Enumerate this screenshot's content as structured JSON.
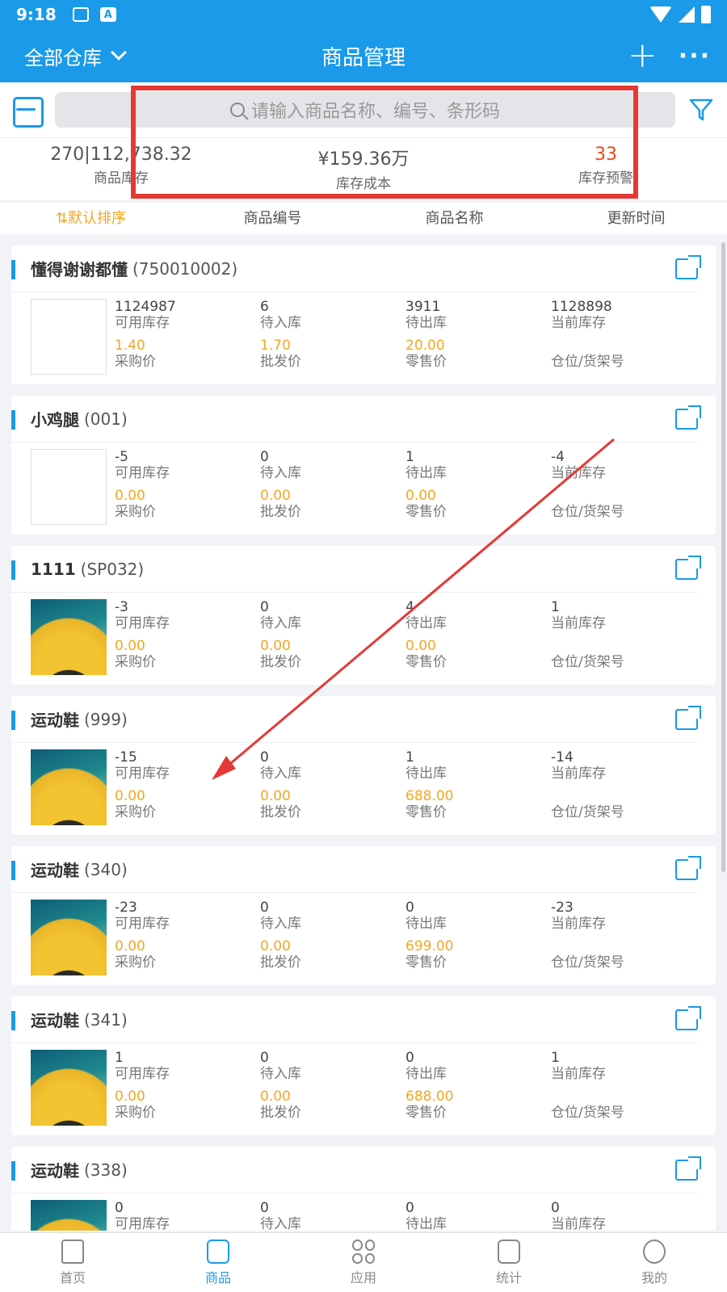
{
  "status_bar": {
    "time": "9:18"
  },
  "app_bar": {
    "warehouse": "全部仓库",
    "title": "商品管理"
  },
  "search": {
    "placeholder": "请输入商品名称、编号、条形码"
  },
  "summary": [
    {
      "value": "270|112,738.32",
      "label": "商品库存"
    },
    {
      "value": "¥159.36万",
      "label": "库存成本"
    },
    {
      "value": "33",
      "label": "库存预警"
    }
  ],
  "sort_tabs": [
    "⇅默认排序",
    "商品编号",
    "商品名称",
    "更新时间"
  ],
  "field_labels": {
    "available": "可用库存",
    "incoming": "待入库",
    "outgoing": "待出库",
    "current": "当前库存",
    "purchase": "采购价",
    "wholesale": "批发价",
    "retail": "零售价",
    "location": "仓位/货架号"
  },
  "products": [
    {
      "name": "懂得谢谢都懂",
      "code": "(750010002)",
      "image": false,
      "available": "1124987",
      "incoming": "6",
      "outgoing": "3911",
      "current": "1128898",
      "purchase": "1.40",
      "wholesale": "1.70",
      "retail": "20.00"
    },
    {
      "name": "小鸡腿",
      "code": "(001)",
      "image": false,
      "available": "-5",
      "incoming": "0",
      "outgoing": "1",
      "current": "-4",
      "purchase": "0.00",
      "wholesale": "0.00",
      "retail": "0.00"
    },
    {
      "name": "1111",
      "code": "(SP032)",
      "image": true,
      "available": "-3",
      "incoming": "0",
      "outgoing": "4",
      "current": "1",
      "purchase": "0.00",
      "wholesale": "0.00",
      "retail": "0.00"
    },
    {
      "name": "运动鞋",
      "code": "(999)",
      "image": true,
      "available": "-15",
      "incoming": "0",
      "outgoing": "1",
      "current": "-14",
      "purchase": "0.00",
      "wholesale": "0.00",
      "retail": "688.00"
    },
    {
      "name": "运动鞋",
      "code": "(340)",
      "image": true,
      "available": "-23",
      "incoming": "0",
      "outgoing": "0",
      "current": "-23",
      "purchase": "0.00",
      "wholesale": "0.00",
      "retail": "699.00"
    },
    {
      "name": "运动鞋",
      "code": "(341)",
      "image": true,
      "available": "1",
      "incoming": "0",
      "outgoing": "0",
      "current": "1",
      "purchase": "0.00",
      "wholesale": "0.00",
      "retail": "688.00"
    },
    {
      "name": "运动鞋",
      "code": "(338)",
      "image": true,
      "available": "0",
      "incoming": "0",
      "outgoing": "0",
      "current": "0",
      "purchase": "",
      "wholesale": "",
      "retail": ""
    }
  ],
  "bottom_nav": [
    {
      "label": "首页",
      "icon": "home-icon"
    },
    {
      "label": "商品",
      "icon": "goods-icon",
      "active": true
    },
    {
      "label": "应用",
      "icon": "apps-icon"
    },
    {
      "label": "统计",
      "icon": "chart-icon"
    },
    {
      "label": "我的",
      "icon": "profile-icon"
    }
  ],
  "colors": {
    "primary": "#1a9ae8",
    "price": "#f5a623",
    "warning": "#e64a19",
    "annotation": "#e53935"
  }
}
